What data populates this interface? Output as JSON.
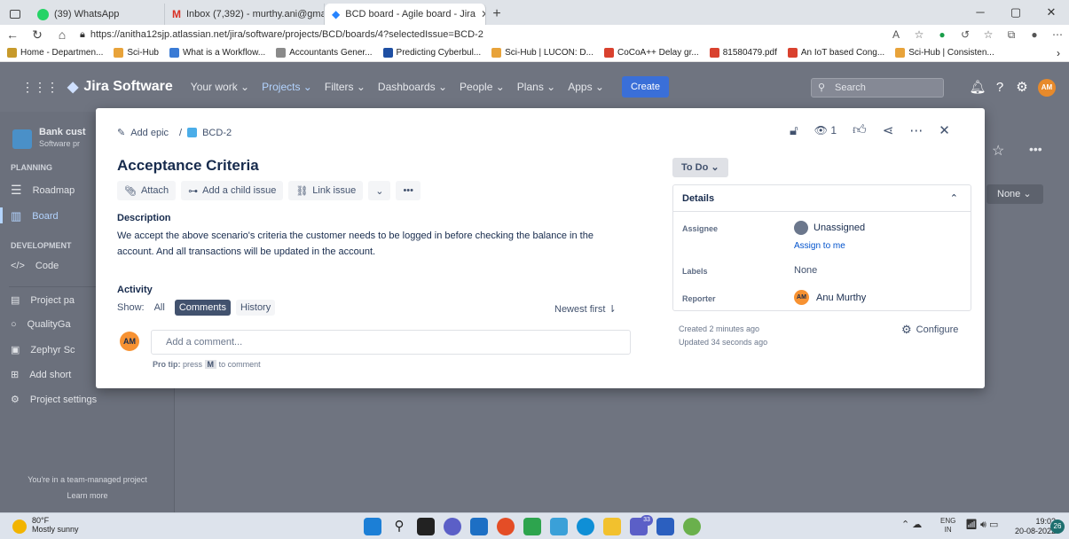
{
  "browser": {
    "tabs": [
      {
        "title": "(39) WhatsApp"
      },
      {
        "title": "Inbox (7,392) - murthy.ani@gma"
      },
      {
        "title": "BCD board - Agile board - Jira"
      }
    ],
    "new_tab": "+",
    "url": "https://anitha12sjp.atlassian.net/jira/software/projects/BCD/boards/4?selectedIssue=BCD-2",
    "bookmarks": [
      {
        "label": "Home - Departmen..."
      },
      {
        "label": "Sci-Hub"
      },
      {
        "label": "What is a Workflow..."
      },
      {
        "label": "Accountants Gener..."
      },
      {
        "label": "Predicting Cyberbul..."
      },
      {
        "label": "Sci-Hub | LUCON: D..."
      },
      {
        "label": "CoCoA++ Delay gr..."
      },
      {
        "label": "81580479.pdf"
      },
      {
        "label": "An IoT based Cong..."
      },
      {
        "label": "Sci-Hub | Consisten..."
      }
    ]
  },
  "jira": {
    "product": "Jira Software",
    "menus": [
      "Your work",
      "Projects",
      "Filters",
      "Dashboards",
      "People",
      "Plans",
      "Apps"
    ],
    "create": "Create",
    "search_placeholder": "Search",
    "user_initials": "AM"
  },
  "sidebar": {
    "project_name": "Bank cust",
    "project_type": "Software pr",
    "planning_header": "PLANNING",
    "roadmap": "Roadmap",
    "board": "Board",
    "development_header": "DEVELOPMENT",
    "code": "Code",
    "items": [
      "Project pa",
      "QualityGa",
      "Zephyr Sc",
      "Add short",
      "Project settings"
    ],
    "footer_line1": "You're in a team-managed project",
    "footer_line2": "Learn more"
  },
  "board_bg": {
    "none_dropdown": "None"
  },
  "issue": {
    "add_epic": "Add epic",
    "separator": "/",
    "key": "BCD-2",
    "watchers": "1",
    "title": "Acceptance Criteria",
    "toolbar": {
      "attach": "Attach",
      "child": "Add a child issue",
      "link": "Link issue",
      "more": "•••"
    },
    "description_label": "Description",
    "description": "We accept the above scenario's criteria the customer needs to be logged in before checking the balance in the account.  And all transactions will be updated in the account.",
    "activity_label": "Activity",
    "show_label": "Show:",
    "filters": [
      "All",
      "Comments",
      "History"
    ],
    "sort": "Newest first",
    "commenter_initials": "AM",
    "comment_placeholder": "Add a comment...",
    "pro_tip_prefix": "Pro tip:",
    "pro_tip_mid": "press",
    "pro_tip_key": "M",
    "pro_tip_suffix": "to comment",
    "status": "To Do",
    "details_label": "Details",
    "assignee_label": "Assignee",
    "assignee_value": "Unassigned",
    "assign_to_me": "Assign to me",
    "labels_label": "Labels",
    "labels_value": "None",
    "reporter_label": "Reporter",
    "reporter_initials": "AM",
    "reporter_value": "Anu Murthy",
    "created": "Created 2 minutes ago",
    "updated": "Updated 34 seconds ago",
    "configure": "Configure"
  },
  "taskbar": {
    "temp": "80°F",
    "weather": "Mostly sunny",
    "lang_top": "ENG",
    "lang_bottom": "IN",
    "time": "19:02",
    "date": "20-08-2022",
    "badge": "26",
    "teams_badge": "33"
  },
  "colors": {
    "jira_blue": "#0052cc",
    "status_gray": "#dfe1e6",
    "avatar_orange": "#f79232"
  }
}
